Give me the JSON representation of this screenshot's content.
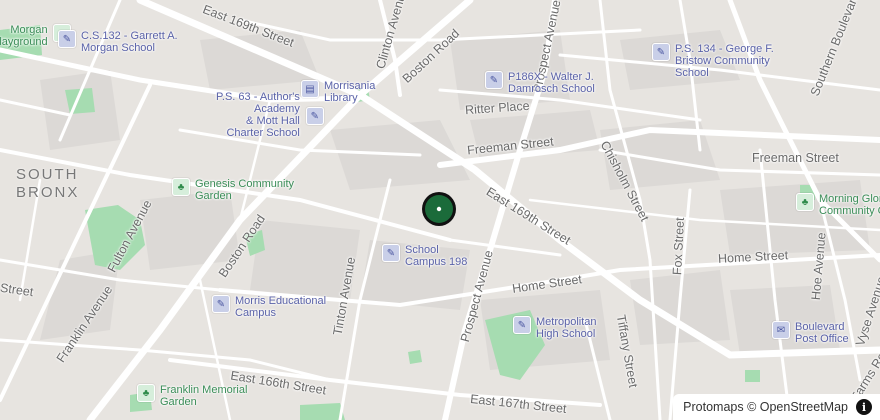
{
  "map": {
    "district": "SOUTH\nBRONX",
    "streets": {
      "east_169th_nw": "East 169th Street",
      "east_169th_se": "East 169th Street",
      "clinton_avenue": "Clinton Avenue",
      "boston_road_n": "Boston Road",
      "boston_road_s": "Boston Road",
      "prospect_avenue_n": "Prospect Avenue",
      "prospect_avenue_s": "Prospect Avenue",
      "ritter_place": "Ritter Place",
      "freeman_street_w": "Freeman Street",
      "freeman_street_e": "Freeman Street",
      "chisholm_street": "Chisholm Street",
      "southern_boulevard": "Southern Boulevard",
      "fulton_avenue": "Fulton Avenue",
      "franklin_avenue": "Franklin Avenue",
      "tinton_avenue": "Tinton Avenue",
      "home_street_w": "Home Street",
      "home_street_e": "Home Street",
      "fox_street": "Fox Street",
      "hoe_avenue": "Hoe Avenue",
      "vyse_avenue": "Vyse Avenue",
      "tiffany_street": "Tiffany Street",
      "east_166th": "East 166th Street",
      "east_167th": "East 167th Street",
      "farms_road": "Farms Road",
      "street_fragment": "Street"
    },
    "pois": {
      "morgan_playground": "Morgan\nPlayground",
      "cs132": "C.S.132 - Garrett A.\nMorgan School",
      "morrisania_library": "Morrisania\nLibrary",
      "ps63": "P.S. 63 - Author's\nAcademy\n& Mott Hall\nCharter School",
      "p186x": "P186X - Walter J.\nDamrosch School",
      "ps134": "P.S. 134 - George F.\nBristow Community\nSchool",
      "genesis_garden": "Genesis Community\nGarden",
      "school_campus_198": "School\nCampus 198",
      "morris_campus": "Morris Educational\nCampus",
      "metropolitan_hs": "Metropolitan\nHigh School",
      "franklin_garden": "Franklin Memorial\nGarden",
      "morning_glory": "Morning Glory\nCommunity Ga",
      "boulevard_po": "Boulevard\nPost Office"
    }
  },
  "attribution": {
    "text": "Protomaps © OpenStreetMap",
    "info_glyph": "i"
  },
  "colors": {
    "background": "#e7e4e0",
    "road": "#ffffff",
    "park": "#a6dcb1",
    "school_label": "#5a62a8",
    "park_label": "#3b8d58",
    "marker": "#1b6b3a"
  }
}
